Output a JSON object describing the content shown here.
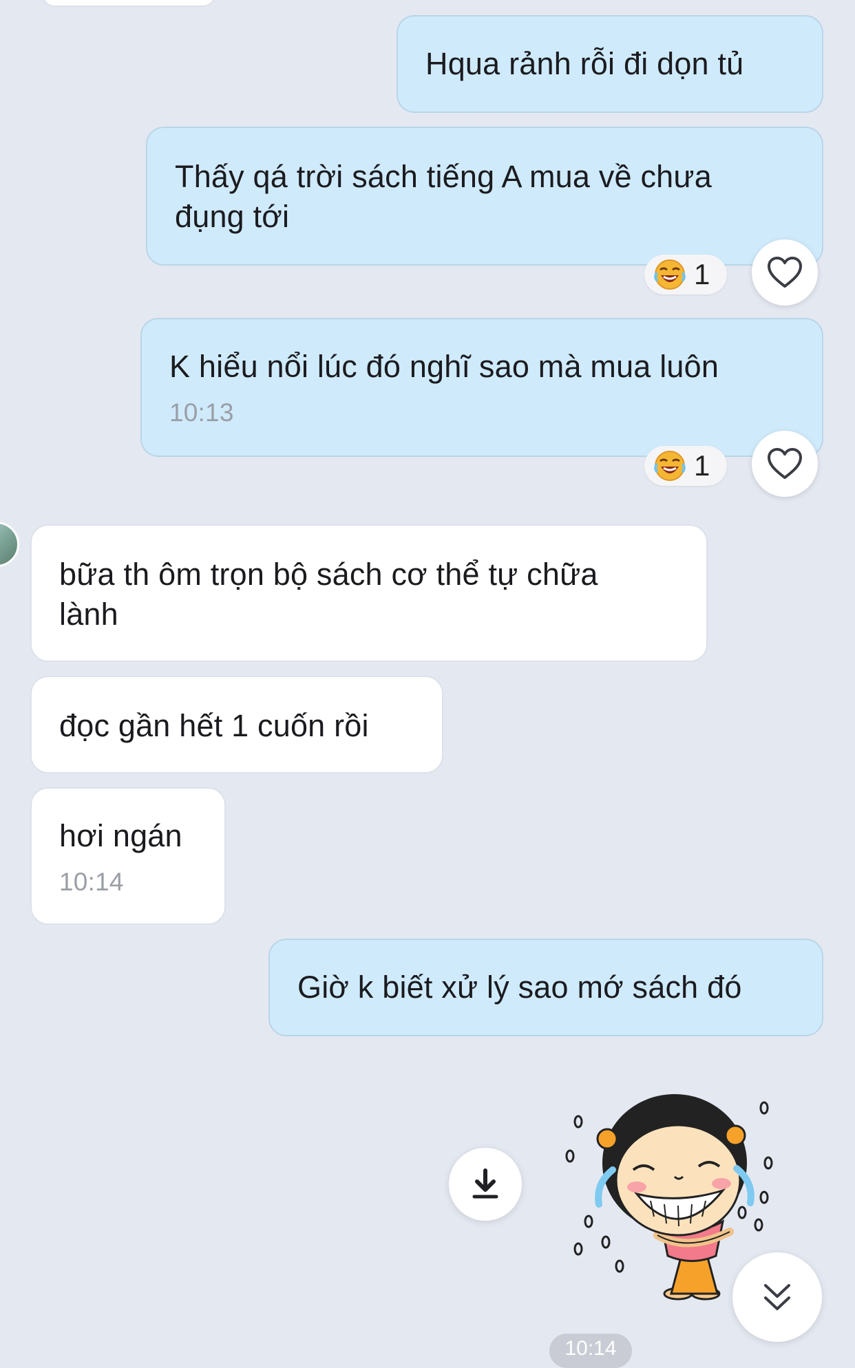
{
  "messages": {
    "m1": {
      "text": "Hqua rảnh rỗi đi dọn tủ"
    },
    "m2": {
      "line1": "Thấy qá trời sách tiếng A mua về chưa",
      "line2": "đụng tới",
      "reaction_count": "1"
    },
    "m3": {
      "text": "K hiểu nổi lúc đó nghĩ sao mà mua luôn",
      "time": "10:13",
      "reaction_count": "1"
    },
    "m4": {
      "line1": "bữa th ôm trọn bộ sách cơ thể tự chữa",
      "line2": "lành"
    },
    "m5": {
      "text": "đọc gần hết 1 cuốn rồi"
    },
    "m6": {
      "text": "hơi ngán",
      "time": "10:14"
    },
    "m7": {
      "text": "Giờ k biết xử lý sao mớ sách đó"
    }
  },
  "bottom_time": "10:14",
  "icons": {
    "reaction": "laughing-crying-emoji",
    "like": "heart-icon",
    "download": "download-icon",
    "scroll": "double-chevron-down-icon",
    "sticker": "crying-laughing-girl-sticker"
  },
  "colors": {
    "background": "#e4e8f1",
    "sent_bubble": "#cfeafb",
    "received_bubble": "#ffffff",
    "timestamp": "#9a9ea6"
  }
}
